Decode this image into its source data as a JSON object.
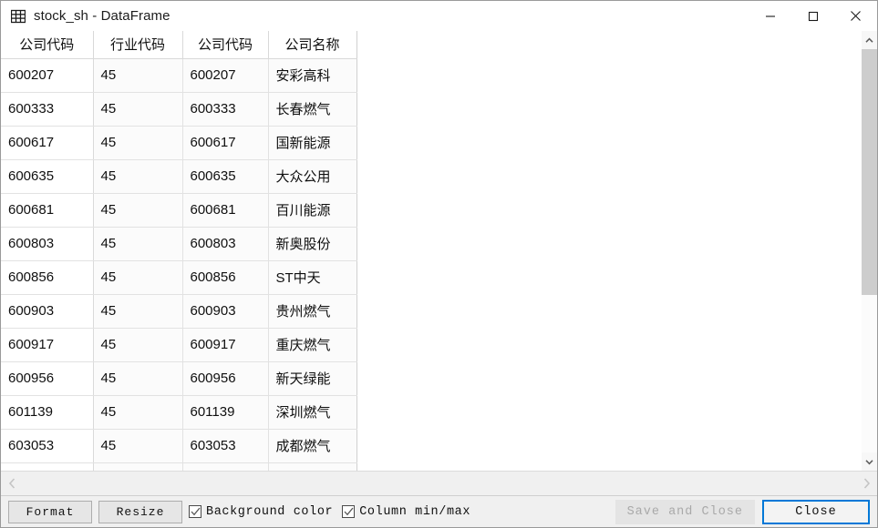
{
  "window": {
    "title": "stock_sh - DataFrame",
    "icon": "table-grid-icon",
    "controls": {
      "minimize": "minimize-icon",
      "maximize": "maximize-icon",
      "close": "close-icon"
    }
  },
  "table": {
    "index_header": "公司代码",
    "headers": [
      "行业代码",
      "公司代码",
      "公司名称"
    ],
    "rows": [
      {
        "index": "600207",
        "cells": [
          "45",
          "600207",
          "安彩高科"
        ]
      },
      {
        "index": "600333",
        "cells": [
          "45",
          "600333",
          "长春燃气"
        ]
      },
      {
        "index": "600617",
        "cells": [
          "45",
          "600617",
          "国新能源"
        ]
      },
      {
        "index": "600635",
        "cells": [
          "45",
          "600635",
          "大众公用"
        ]
      },
      {
        "index": "600681",
        "cells": [
          "45",
          "600681",
          "百川能源"
        ]
      },
      {
        "index": "600803",
        "cells": [
          "45",
          "600803",
          "新奥股份"
        ]
      },
      {
        "index": "600856",
        "cells": [
          "45",
          "600856",
          "ST中天"
        ]
      },
      {
        "index": "600903",
        "cells": [
          "45",
          "600903",
          "贵州燃气"
        ]
      },
      {
        "index": "600917",
        "cells": [
          "45",
          "600917",
          "重庆燃气"
        ]
      },
      {
        "index": "600956",
        "cells": [
          "45",
          "600956",
          "新天绿能"
        ]
      },
      {
        "index": "601139",
        "cells": [
          "45",
          "601139",
          "深圳燃气"
        ]
      },
      {
        "index": "603053",
        "cells": [
          "45",
          "603053",
          "成都燃气"
        ]
      },
      {
        "index": "",
        "cells": [
          "",
          "",
          ""
        ]
      }
    ]
  },
  "scrollbars": {
    "vertical": {
      "up_icon": "chevron-up-icon",
      "down_icon": "chevron-down-icon"
    },
    "horizontal": {
      "left_icon": "chevron-left-icon",
      "right_icon": "chevron-right-icon"
    }
  },
  "toolbar": {
    "format_label": "Format",
    "resize_label": "Resize",
    "background_color_label": "Background color",
    "background_color_checked": true,
    "column_minmax_label": "Column min/max",
    "column_minmax_checked": true,
    "save_and_close_label": "Save and Close",
    "save_and_close_enabled": false,
    "close_label": "Close",
    "close_focused": true
  },
  "colors": {
    "focus_border": "#0078d7",
    "toolbar_background": "#f0f0f0",
    "cell_background": "#fbfbfb",
    "scroll_thumb": "#cdcdcd"
  }
}
